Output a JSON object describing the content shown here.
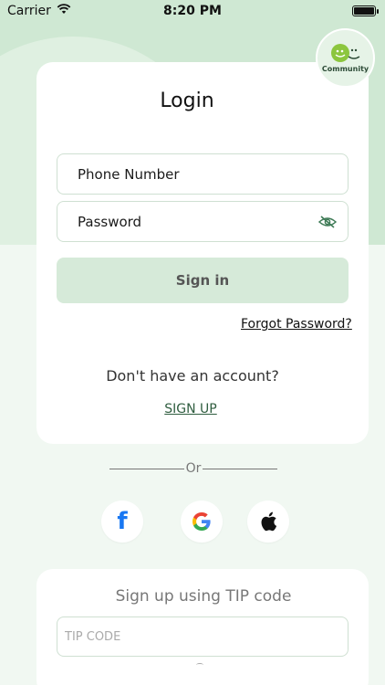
{
  "status_bar": {
    "carrier": "Carrier",
    "time": "8:20 PM"
  },
  "community": {
    "label": "Community"
  },
  "login": {
    "title": "Login",
    "phone_label": "Phone Number",
    "password_label": "Password",
    "signin_label": "Sign in",
    "forgot_label": "Forgot Password?",
    "no_account_text": "Don't have an account?",
    "signup_label": "SIGN UP"
  },
  "divider": {
    "or_text": "Or"
  },
  "social": {
    "facebook_glyph": "f",
    "google_glyph": "G"
  },
  "tip": {
    "title": "Sign up using  TIP code",
    "placeholder": "TIP CODE"
  },
  "colors": {
    "accent_green": "#cfe8d3",
    "button_green": "#d6ead9",
    "link_green": "#2f5d3f",
    "logo_green": "#8cc63e",
    "facebook_blue": "#1877f2"
  }
}
